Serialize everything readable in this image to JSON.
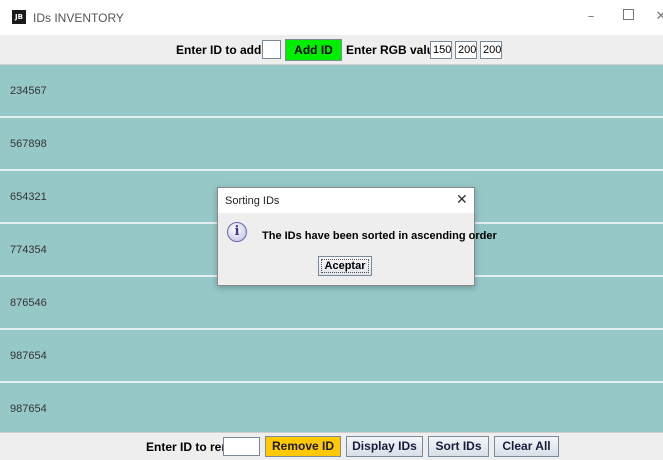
{
  "window": {
    "icon_text": "JB",
    "title": "IDs INVENTORY",
    "minimize": "–",
    "close": "✕"
  },
  "toolbar_top": {
    "add_label": "Enter ID to add:",
    "add_value": "",
    "add_button": "Add ID",
    "add_button_color": "#00ee00",
    "rgb_label": "Enter RGB values:",
    "r": "150",
    "g": "200",
    "b": "200"
  },
  "list": {
    "row_color": "#96c8c8",
    "items": [
      "234567",
      "567898",
      "654321",
      "774354",
      "876546",
      "987654",
      "987654"
    ]
  },
  "toolbar_bottom": {
    "remove_label": "Enter ID to remove:",
    "remove_value": "",
    "remove_button": "Remove ID",
    "remove_button_color": "#ffc800",
    "display_button": "Display IDs",
    "sort_button": "Sort IDs",
    "clear_button": "Clear All"
  },
  "dialog": {
    "title": "Sorting IDs",
    "close": "✕",
    "icon": "info-icon",
    "icon_glyph": "i",
    "message": "The IDs have been sorted in ascending order",
    "ok_button": "Aceptar"
  }
}
